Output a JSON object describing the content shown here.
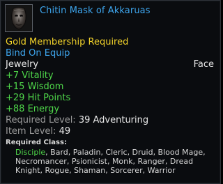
{
  "item": {
    "name": "Chitin Mask of Akkaruas",
    "icon": "mask-icon",
    "membership": "Gold Membership Required",
    "bind": "Bind On Equip",
    "type": "Jewelry",
    "slot": "Face",
    "stats": [
      "+7 Vitality",
      "+15 Wisdom",
      "+29 Hit Points",
      "+88 Energy"
    ],
    "required_level_label": "Required Level:",
    "required_level_value": "39 Adventuring",
    "item_level_label": "Item Level:",
    "item_level_value": "49",
    "required_class_label": "Required Class:",
    "classes_primary": "Disciple",
    "classes_rest_line1": ", Bard, Paladin, Cleric, Druid, Blood Mage,",
    "classes_line2": "Necromancer, Psionicist, Monk, Ranger, Dread",
    "classes_line3": "Knight, Rogue, Shaman, Sorcerer, Warrior"
  },
  "colors": {
    "title": "#3ea6ee",
    "membership": "#f2d22a",
    "bind": "#3ea6ee",
    "stat": "#4fd84a",
    "label_grey": "#9a9a9a",
    "white": "#e8e8e8"
  }
}
